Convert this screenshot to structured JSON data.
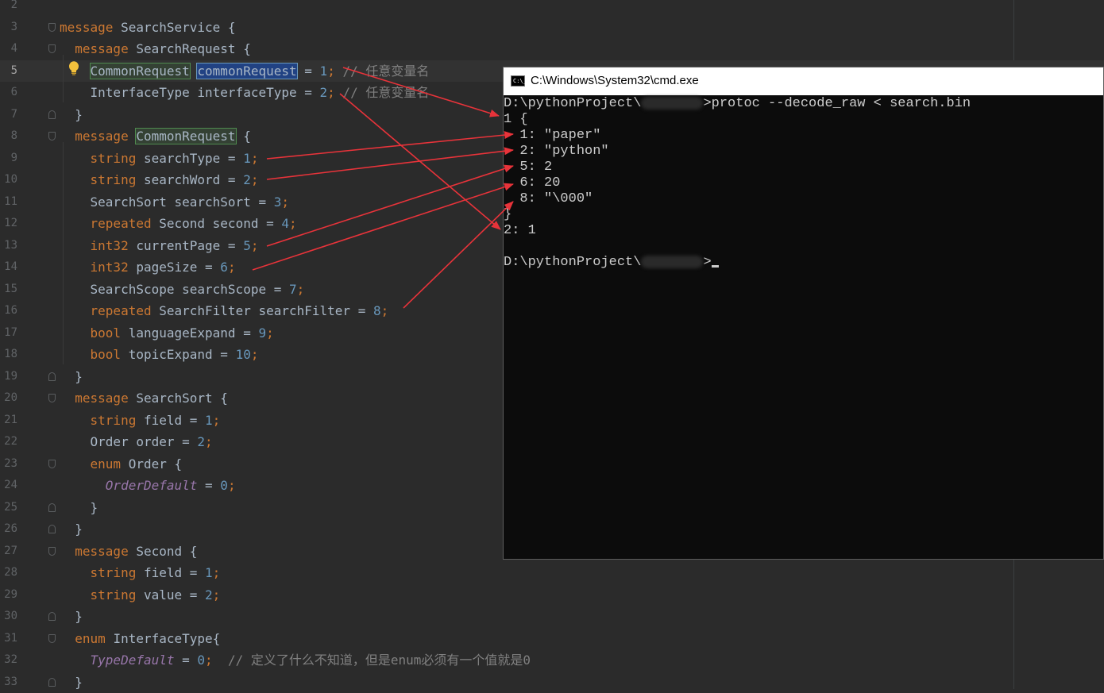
{
  "editor": {
    "lines": [
      {
        "n": "2",
        "tokens": []
      },
      {
        "n": "3",
        "tokens": [
          [
            "kw",
            "message "
          ],
          [
            "tk",
            "SearchService {"
          ]
        ]
      },
      {
        "n": "4",
        "tokens": [
          [
            "tk",
            "  "
          ],
          [
            "kw",
            "message "
          ],
          [
            "tk",
            "SearchRequest {"
          ]
        ]
      },
      {
        "n": "5",
        "tokens": [
          [
            "tk",
            "    "
          ],
          [
            "hlg",
            "CommonRequest"
          ],
          [
            "tk",
            " "
          ],
          [
            "hlb",
            "commonRequest"
          ],
          [
            "tk",
            " = "
          ],
          [
            "num",
            "1"
          ],
          [
            "kw",
            ";"
          ],
          [
            "cm",
            " // 任意变量名"
          ]
        ]
      },
      {
        "n": "6",
        "tokens": [
          [
            "tk",
            "    InterfaceType interfaceType = "
          ],
          [
            "num",
            "2"
          ],
          [
            "kw",
            ";"
          ],
          [
            "cm",
            " // 任意变量名"
          ]
        ]
      },
      {
        "n": "7",
        "tokens": [
          [
            "tk",
            "  }"
          ]
        ]
      },
      {
        "n": "8",
        "tokens": [
          [
            "tk",
            "  "
          ],
          [
            "kw",
            "message "
          ],
          [
            "hlg",
            "CommonRequest"
          ],
          [
            "tk",
            " {"
          ]
        ]
      },
      {
        "n": "9",
        "tokens": [
          [
            "tk",
            "    "
          ],
          [
            "kw",
            "string "
          ],
          [
            "tk",
            "searchType = "
          ],
          [
            "num",
            "1"
          ],
          [
            "kw",
            ";"
          ]
        ]
      },
      {
        "n": "10",
        "tokens": [
          [
            "tk",
            "    "
          ],
          [
            "kw",
            "string "
          ],
          [
            "tk",
            "searchWord = "
          ],
          [
            "num",
            "2"
          ],
          [
            "kw",
            ";"
          ]
        ]
      },
      {
        "n": "11",
        "tokens": [
          [
            "tk",
            "    SearchSort searchSort = "
          ],
          [
            "num",
            "3"
          ],
          [
            "kw",
            ";"
          ]
        ]
      },
      {
        "n": "12",
        "tokens": [
          [
            "tk",
            "    "
          ],
          [
            "kw",
            "repeated "
          ],
          [
            "tk",
            "Second second = "
          ],
          [
            "num",
            "4"
          ],
          [
            "kw",
            ";"
          ]
        ]
      },
      {
        "n": "13",
        "tokens": [
          [
            "tk",
            "    "
          ],
          [
            "kw",
            "int32 "
          ],
          [
            "tk",
            "currentPage = "
          ],
          [
            "num",
            "5"
          ],
          [
            "kw",
            ";"
          ]
        ]
      },
      {
        "n": "14",
        "tokens": [
          [
            "tk",
            "    "
          ],
          [
            "kw",
            "int32 "
          ],
          [
            "tk",
            "pageSize = "
          ],
          [
            "num",
            "6"
          ],
          [
            "kw",
            ";"
          ]
        ]
      },
      {
        "n": "15",
        "tokens": [
          [
            "tk",
            "    SearchScope searchScope = "
          ],
          [
            "num",
            "7"
          ],
          [
            "kw",
            ";"
          ]
        ]
      },
      {
        "n": "16",
        "tokens": [
          [
            "tk",
            "    "
          ],
          [
            "kw",
            "repeated "
          ],
          [
            "tk",
            "SearchFilter searchFilter = "
          ],
          [
            "num",
            "8"
          ],
          [
            "kw",
            ";"
          ]
        ]
      },
      {
        "n": "17",
        "tokens": [
          [
            "tk",
            "    "
          ],
          [
            "kw",
            "bool "
          ],
          [
            "tk",
            "languageExpand = "
          ],
          [
            "num",
            "9"
          ],
          [
            "kw",
            ";"
          ]
        ]
      },
      {
        "n": "18",
        "tokens": [
          [
            "tk",
            "    "
          ],
          [
            "kw",
            "bool "
          ],
          [
            "tk",
            "topicExpand = "
          ],
          [
            "num",
            "10"
          ],
          [
            "kw",
            ";"
          ]
        ]
      },
      {
        "n": "19",
        "tokens": [
          [
            "tk",
            "  }"
          ]
        ]
      },
      {
        "n": "20",
        "tokens": [
          [
            "tk",
            "  "
          ],
          [
            "kw",
            "message "
          ],
          [
            "tk",
            "SearchSort {"
          ]
        ]
      },
      {
        "n": "21",
        "tokens": [
          [
            "tk",
            "    "
          ],
          [
            "kw",
            "string "
          ],
          [
            "tk",
            "field = "
          ],
          [
            "num",
            "1"
          ],
          [
            "kw",
            ";"
          ]
        ]
      },
      {
        "n": "22",
        "tokens": [
          [
            "tk",
            "    Order order = "
          ],
          [
            "num",
            "2"
          ],
          [
            "kw",
            ";"
          ]
        ]
      },
      {
        "n": "23",
        "tokens": [
          [
            "tk",
            "    "
          ],
          [
            "kw",
            "enum "
          ],
          [
            "tk",
            "Order {"
          ]
        ]
      },
      {
        "n": "24",
        "tokens": [
          [
            "tk",
            "      "
          ],
          [
            "en",
            "OrderDefault"
          ],
          [
            "tk",
            " = "
          ],
          [
            "num",
            "0"
          ],
          [
            "kw",
            ";"
          ]
        ]
      },
      {
        "n": "25",
        "tokens": [
          [
            "tk",
            "    }"
          ]
        ]
      },
      {
        "n": "26",
        "tokens": [
          [
            "tk",
            "  }"
          ]
        ]
      },
      {
        "n": "27",
        "tokens": [
          [
            "tk",
            "  "
          ],
          [
            "kw",
            "message "
          ],
          [
            "tk",
            "Second {"
          ]
        ]
      },
      {
        "n": "28",
        "tokens": [
          [
            "tk",
            "    "
          ],
          [
            "kw",
            "string "
          ],
          [
            "tk",
            "field = "
          ],
          [
            "num",
            "1"
          ],
          [
            "kw",
            ";"
          ]
        ]
      },
      {
        "n": "29",
        "tokens": [
          [
            "tk",
            "    "
          ],
          [
            "kw",
            "string "
          ],
          [
            "tk",
            "value = "
          ],
          [
            "num",
            "2"
          ],
          [
            "kw",
            ";"
          ]
        ]
      },
      {
        "n": "30",
        "tokens": [
          [
            "tk",
            "  }"
          ]
        ]
      },
      {
        "n": "31",
        "tokens": [
          [
            "tk",
            "  "
          ],
          [
            "kw",
            "enum "
          ],
          [
            "tk",
            "InterfaceType{"
          ]
        ]
      },
      {
        "n": "32",
        "tokens": [
          [
            "tk",
            "    "
          ],
          [
            "en",
            "TypeDefault"
          ],
          [
            "tk",
            " = "
          ],
          [
            "num",
            "0"
          ],
          [
            "kw",
            ";"
          ],
          [
            "cm",
            "  // 定义了什么不知道，但是enum必须有一个值就是0"
          ]
        ]
      },
      {
        "n": "33",
        "tokens": [
          [
            "tk",
            "  }"
          ]
        ]
      }
    ]
  },
  "cmd": {
    "title": "C:\\Windows\\System32\\cmd.exe",
    "icon_text": "C:\\_",
    "prompt_prefix": "D:\\pythonProject\\",
    "command": ">protoc --decode_raw < search.bin",
    "prompt_suffix": ">",
    "output": [
      "1 {",
      "  1: \"paper\"",
      "  2: \"python\"",
      "  5: 2",
      "  6: 20",
      "  8: \"\\000\"",
      "}",
      "2: 1"
    ]
  },
  "colors": {
    "editor_bg": "#2b2b2b",
    "keyword": "#cc7832",
    "number": "#6897bb",
    "text": "#a9b7c6",
    "comment": "#808080",
    "enum_constant": "#9876aa",
    "arrow": "#e8333a",
    "console_bg": "#0c0c0c"
  }
}
